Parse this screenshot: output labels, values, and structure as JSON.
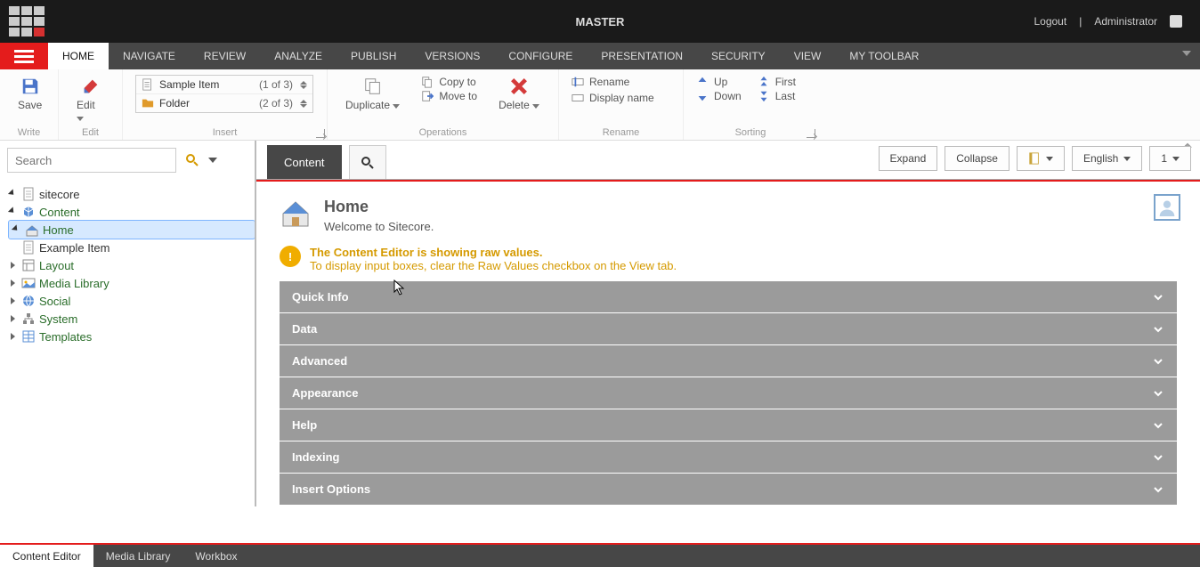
{
  "topbar": {
    "title": "MASTER",
    "logout": "Logout",
    "user": "Administrator"
  },
  "tabs": [
    "HOME",
    "NAVIGATE",
    "REVIEW",
    "ANALYZE",
    "PUBLISH",
    "VERSIONS",
    "CONFIGURE",
    "PRESENTATION",
    "SECURITY",
    "VIEW",
    "MY TOOLBAR"
  ],
  "ribbon": {
    "write": {
      "save": "Save",
      "group": "Write"
    },
    "edit": {
      "edit": "Edit",
      "group": "Edit"
    },
    "insert": {
      "group": "Insert",
      "items": [
        {
          "label": "Sample Item",
          "count": "(1 of 3)"
        },
        {
          "label": "Folder",
          "count": "(2 of 3)"
        }
      ]
    },
    "operations": {
      "duplicate": "Duplicate",
      "copyto": "Copy to",
      "moveto": "Move to",
      "delete": "Delete",
      "group": "Operations"
    },
    "rename": {
      "rename": "Rename",
      "displayname": "Display name",
      "group": "Rename"
    },
    "sorting": {
      "up": "Up",
      "down": "Down",
      "first": "First",
      "last": "Last",
      "group": "Sorting"
    }
  },
  "search": {
    "placeholder": "Search"
  },
  "tree": [
    {
      "label": "sitecore",
      "depth": 0,
      "open": true,
      "ico": "doc",
      "color": "black"
    },
    {
      "label": "Content",
      "depth": 1,
      "open": true,
      "ico": "content"
    },
    {
      "label": "Home",
      "depth": 2,
      "open": true,
      "ico": "home",
      "sel": true
    },
    {
      "label": "Example Item",
      "depth": 3,
      "open": false,
      "ico": "doc",
      "leaf": true,
      "color": "black"
    },
    {
      "label": "Layout",
      "depth": 1,
      "open": false,
      "ico": "layout"
    },
    {
      "label": "Media Library",
      "depth": 1,
      "open": false,
      "ico": "media"
    },
    {
      "label": "Social",
      "depth": 1,
      "open": false,
      "ico": "social"
    },
    {
      "label": "System",
      "depth": 1,
      "open": false,
      "ico": "system"
    },
    {
      "label": "Templates",
      "depth": 1,
      "open": false,
      "ico": "templates"
    }
  ],
  "contentTabs": {
    "content": "Content"
  },
  "controls": {
    "expand": "Expand",
    "collapse": "Collapse",
    "lang": "English",
    "ver": "1"
  },
  "doc": {
    "title": "Home",
    "subtitle": "Welcome to Sitecore.",
    "warn1": "The Content Editor is showing raw values.",
    "warn2": "To display input boxes, clear the Raw Values checkbox on the View tab.",
    "sections": [
      "Quick Info",
      "Data",
      "Advanced",
      "Appearance",
      "Help",
      "Indexing",
      "Insert Options"
    ]
  },
  "bottom": [
    "Content Editor",
    "Media Library",
    "Workbox"
  ]
}
